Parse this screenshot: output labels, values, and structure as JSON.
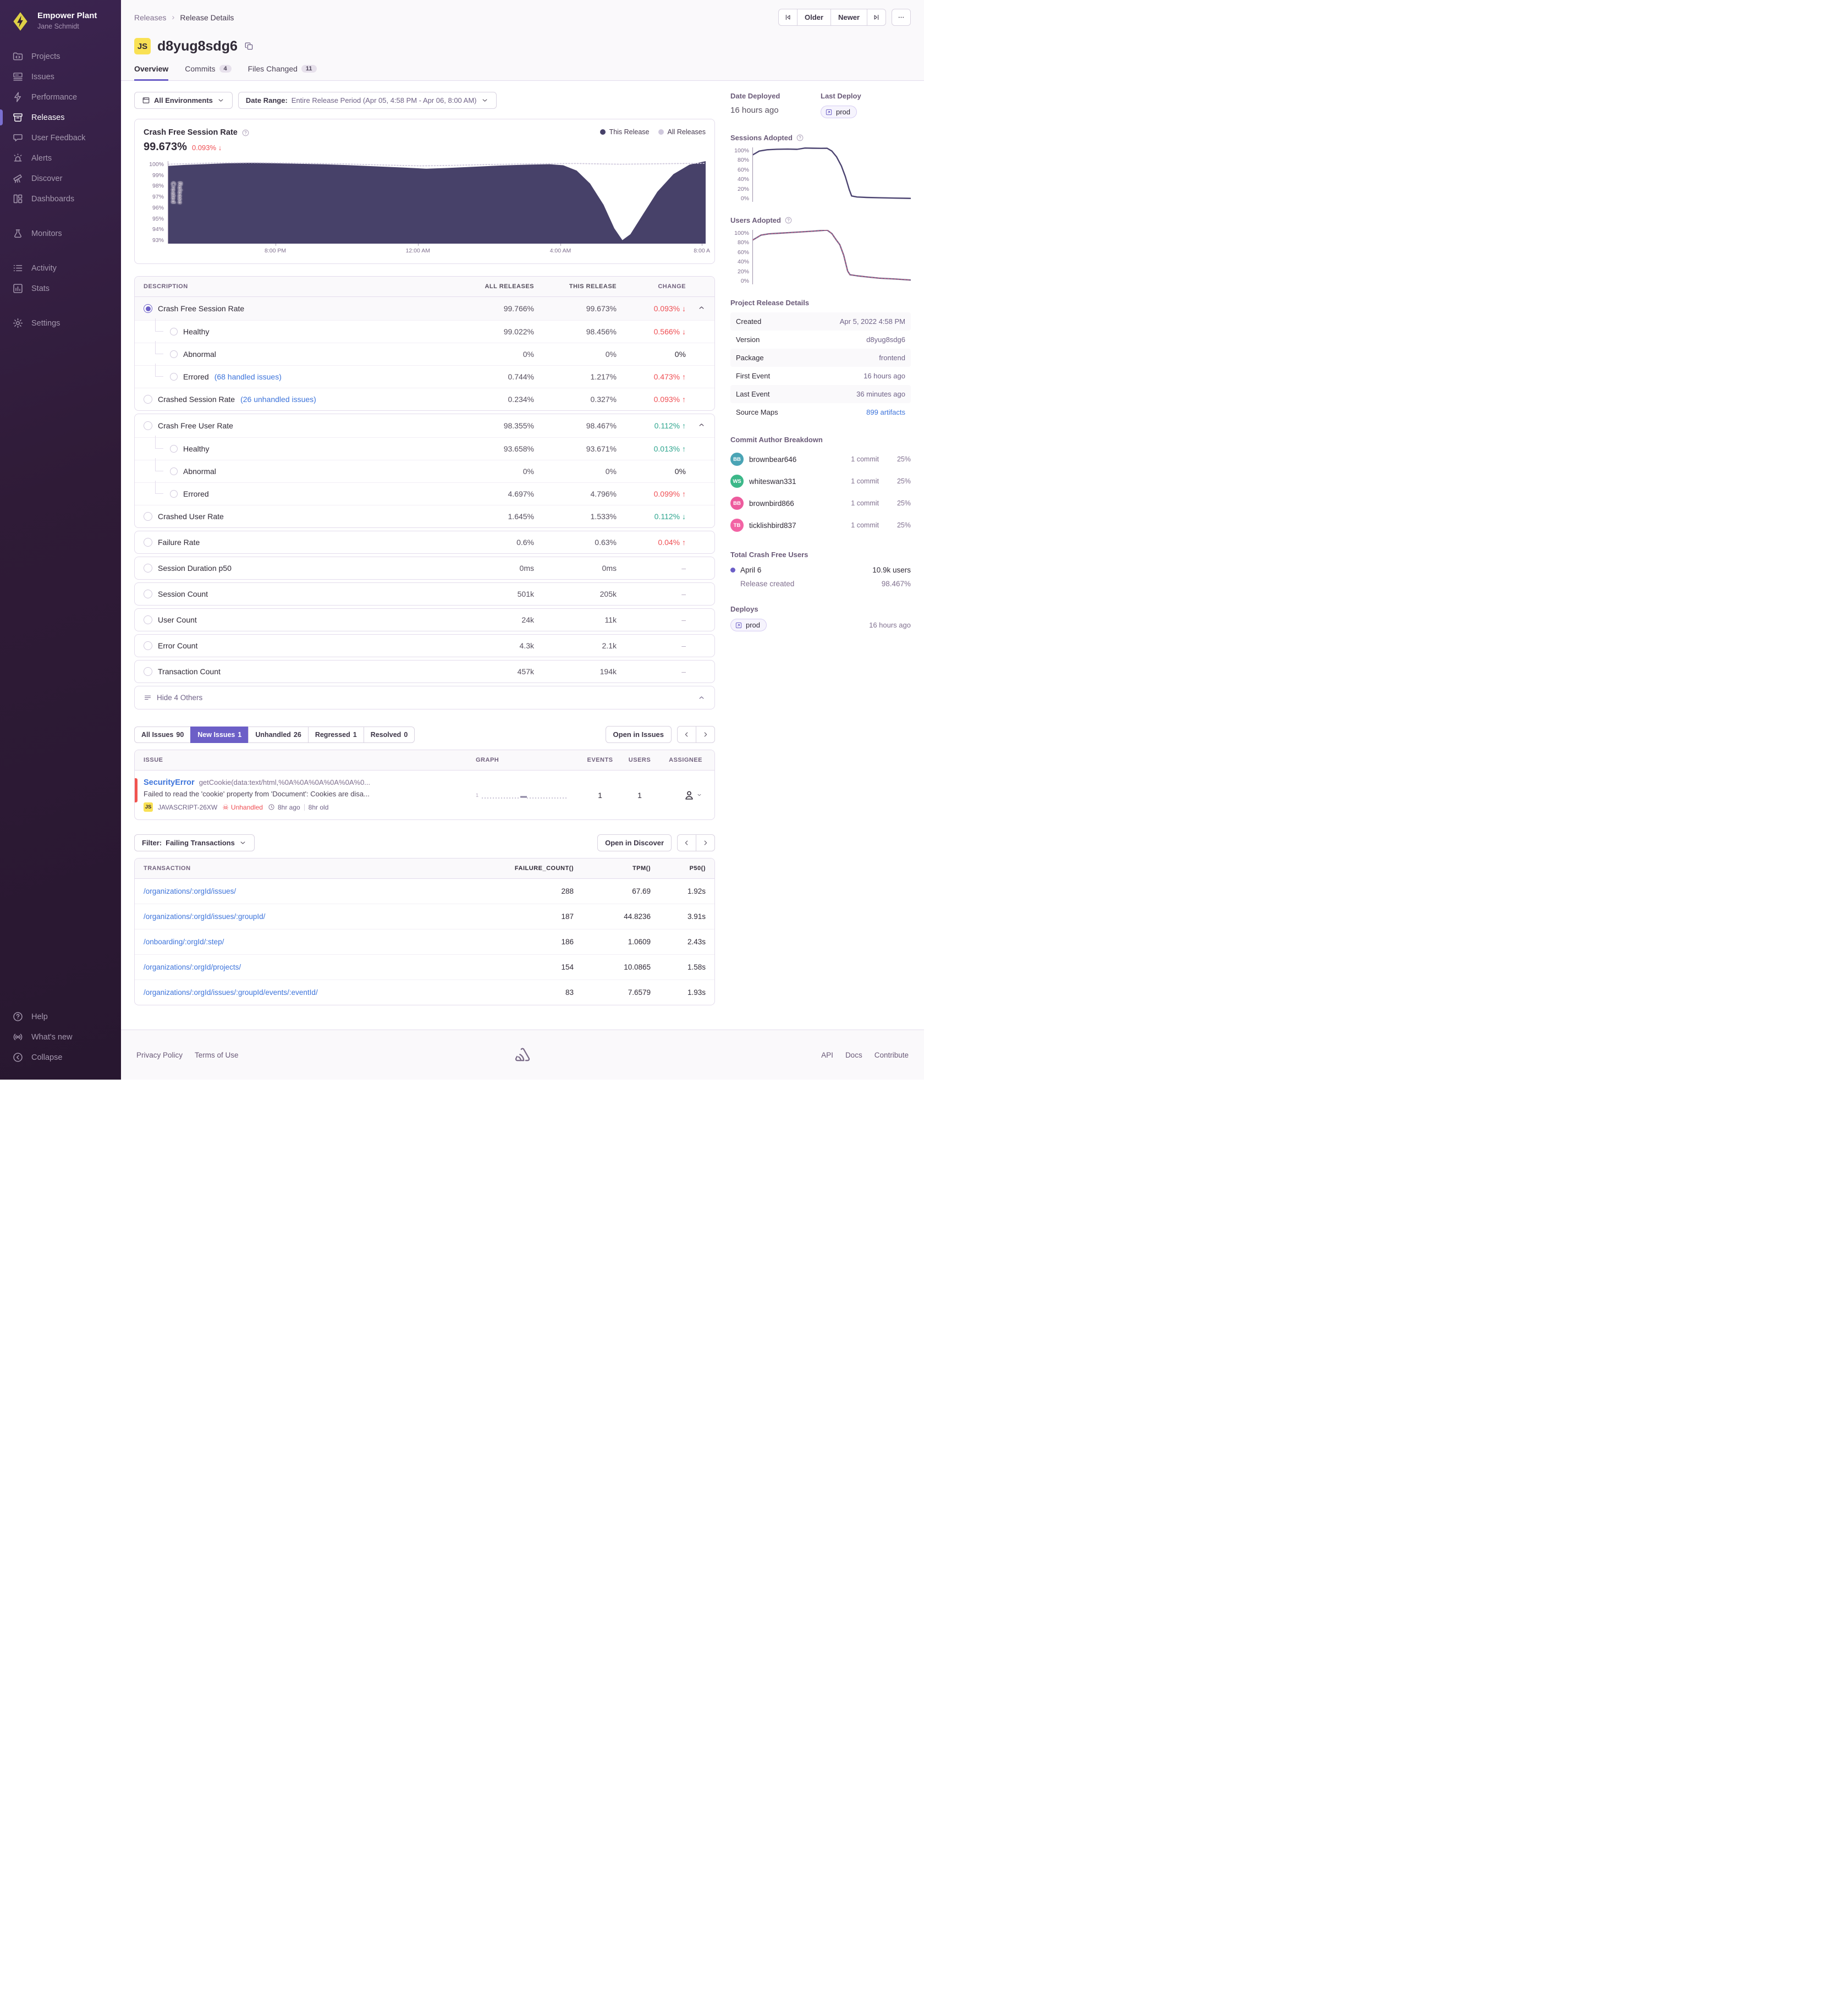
{
  "sidebar": {
    "org": "Empower Plant",
    "user": "Jane Schmidt",
    "groups": [
      [
        {
          "label": "Projects",
          "icon": "projects"
        },
        {
          "label": "Issues",
          "icon": "issues"
        },
        {
          "label": "Performance",
          "icon": "performance"
        },
        {
          "label": "Releases",
          "icon": "releases",
          "active": true
        },
        {
          "label": "User Feedback",
          "icon": "feedback"
        },
        {
          "label": "Alerts",
          "icon": "alerts"
        },
        {
          "label": "Discover",
          "icon": "discover"
        },
        {
          "label": "Dashboards",
          "icon": "dashboards"
        }
      ],
      [
        {
          "label": "Monitors",
          "icon": "monitors"
        }
      ],
      [
        {
          "label": "Activity",
          "icon": "activity"
        },
        {
          "label": "Stats",
          "icon": "stats"
        }
      ],
      [
        {
          "label": "Settings",
          "icon": "settings"
        }
      ]
    ],
    "bottom": [
      {
        "label": "Help",
        "icon": "help"
      },
      {
        "label": "What's new",
        "icon": "whatsnew"
      },
      {
        "label": "Collapse",
        "icon": "collapse"
      }
    ]
  },
  "header": {
    "breadcrumb": [
      "Releases",
      "Release Details"
    ],
    "nav": {
      "older": "Older",
      "newer": "Newer"
    },
    "title_badge": "JS",
    "title": "d8yug8sdg6",
    "tabs": [
      {
        "label": "Overview",
        "active": true
      },
      {
        "label": "Commits",
        "count": "4"
      },
      {
        "label": "Files Changed",
        "count": "11"
      }
    ]
  },
  "filters": {
    "environments": "All Environments",
    "date_range_label": "Date Range:",
    "date_range_value": "Entire Release Period (Apr 05, 4:58 PM - Apr 06, 8:00 AM)"
  },
  "chart_data": [
    {
      "type": "area",
      "title": "Crash Free Session Rate",
      "value": "99.673%",
      "change": "0.093%",
      "change_direction": "down",
      "change_color": "red",
      "annotation": "Release Created",
      "legend": [
        {
          "label": "This Release",
          "color": "#474169"
        },
        {
          "label": "All Releases",
          "color": "#cfc8dc"
        }
      ],
      "ylim": [
        93,
        100
      ],
      "y_ticks": [
        "100%",
        "99%",
        "98%",
        "97%",
        "96%",
        "95%",
        "94%",
        "93%"
      ],
      "x_ticks": [
        {
          "label": "8:00 PM",
          "pos": 0.2
        },
        {
          "label": "12:00 AM",
          "pos": 0.465
        },
        {
          "label": "4:00 AM",
          "pos": 0.73
        },
        {
          "label": "8:00 A",
          "pos": 0.993
        }
      ],
      "series": [
        {
          "name": "This Release",
          "points": [
            [
              0,
              99.6
            ],
            [
              0.03,
              99.68
            ],
            [
              0.07,
              99.75
            ],
            [
              0.11,
              99.82
            ],
            [
              0.15,
              99.86
            ],
            [
              0.19,
              99.83
            ],
            [
              0.24,
              99.78
            ],
            [
              0.29,
              99.73
            ],
            [
              0.34,
              99.65
            ],
            [
              0.39,
              99.55
            ],
            [
              0.44,
              99.45
            ],
            [
              0.48,
              99.36
            ],
            [
              0.52,
              99.42
            ],
            [
              0.57,
              99.53
            ],
            [
              0.62,
              99.63
            ],
            [
              0.67,
              99.7
            ],
            [
              0.71,
              99.74
            ],
            [
              0.735,
              99.65
            ],
            [
              0.76,
              99.2
            ],
            [
              0.785,
              98.1
            ],
            [
              0.81,
              96.3
            ],
            [
              0.83,
              94.3
            ],
            [
              0.845,
              93.3
            ],
            [
              0.86,
              93.8
            ],
            [
              0.885,
              95.6
            ],
            [
              0.91,
              97.4
            ],
            [
              0.94,
              98.9
            ],
            [
              0.97,
              99.7
            ],
            [
              1,
              100
            ]
          ]
        },
        {
          "name": "All Releases",
          "points": [
            [
              0,
              99.74
            ],
            [
              0.08,
              99.84
            ],
            [
              0.16,
              99.87
            ],
            [
              0.25,
              99.82
            ],
            [
              0.33,
              99.76
            ],
            [
              0.41,
              99.66
            ],
            [
              0.47,
              99.6
            ],
            [
              0.53,
              99.64
            ],
            [
              0.6,
              99.72
            ],
            [
              0.68,
              99.78
            ],
            [
              0.76,
              99.8
            ],
            [
              0.84,
              99.74
            ],
            [
              0.92,
              99.78
            ],
            [
              1,
              99.82
            ]
          ]
        }
      ]
    },
    {
      "type": "line",
      "title": "Sessions Adopted",
      "ylim": [
        0,
        100
      ],
      "y_ticks": [
        "100%",
        "80%",
        "60%",
        "40%",
        "20%",
        "0%"
      ],
      "points": [
        [
          0,
          86
        ],
        [
          0.04,
          93
        ],
        [
          0.09,
          95.5
        ],
        [
          0.15,
          96.5
        ],
        [
          0.22,
          96.8
        ],
        [
          0.28,
          96.4
        ],
        [
          0.33,
          98.8
        ],
        [
          0.38,
          98.4
        ],
        [
          0.43,
          98.2
        ],
        [
          0.47,
          98.3
        ],
        [
          0.5,
          93
        ],
        [
          0.53,
          82
        ],
        [
          0.56,
          65
        ],
        [
          0.585,
          45
        ],
        [
          0.61,
          20
        ],
        [
          0.625,
          8
        ],
        [
          0.66,
          6
        ],
        [
          0.72,
          5.2
        ],
        [
          0.8,
          4.6
        ],
        [
          0.9,
          4
        ],
        [
          1,
          3.4
        ]
      ]
    },
    {
      "type": "line",
      "title": "Users Adopted",
      "ylim": [
        0,
        100
      ],
      "y_ticks": [
        "100%",
        "80%",
        "60%",
        "40%",
        "20%",
        "0%"
      ],
      "points": [
        [
          0,
          81
        ],
        [
          0.05,
          90
        ],
        [
          0.1,
          92.5
        ],
        [
          0.17,
          93.8
        ],
        [
          0.24,
          95
        ],
        [
          0.31,
          96.3
        ],
        [
          0.38,
          97.6
        ],
        [
          0.44,
          99
        ],
        [
          0.47,
          99.6
        ],
        [
          0.5,
          93
        ],
        [
          0.53,
          80
        ],
        [
          0.55,
          72
        ],
        [
          0.575,
          52
        ],
        [
          0.6,
          22
        ],
        [
          0.615,
          15
        ],
        [
          0.66,
          13
        ],
        [
          0.72,
          11
        ],
        [
          0.8,
          8.5
        ],
        [
          0.9,
          7
        ],
        [
          1,
          5
        ]
      ]
    }
  ],
  "metrics": {
    "columns": [
      "DESCRIPTION",
      "ALL RELEASES",
      "THIS RELEASE",
      "CHANGE"
    ],
    "groups": [
      {
        "rows": [
          {
            "label": "Crash Free Session Rate",
            "radio": "selected",
            "all": "99.766%",
            "this": "99.673%",
            "change": "0.093%",
            "arrow": "down",
            "change_color": "red",
            "chevron": true,
            "selected_bg": true
          },
          {
            "label": "Healthy",
            "indent": true,
            "radio": "sub",
            "all": "99.022%",
            "this": "98.456%",
            "change": "0.566%",
            "arrow": "down",
            "change_color": "red"
          },
          {
            "label": "Abnormal",
            "indent": true,
            "radio": "sub",
            "all": "0%",
            "this": "0%",
            "change": "0%",
            "change_color": "plain"
          },
          {
            "label": "Errored",
            "link": "(68 handled issues)",
            "indent": true,
            "radio": "sub",
            "all": "0.744%",
            "this": "1.217%",
            "change": "0.473%",
            "arrow": "up",
            "change_color": "red"
          },
          {
            "label": "Crashed Session Rate",
            "link": "(26 unhandled issues)",
            "radio": "unselected",
            "all": "0.234%",
            "this": "0.327%",
            "change": "0.093%",
            "arrow": "up",
            "change_color": "red"
          }
        ]
      },
      {
        "rows": [
          {
            "label": "Crash Free User Rate",
            "radio": "unselected",
            "all": "98.355%",
            "this": "98.467%",
            "change": "0.112%",
            "arrow": "up",
            "change_color": "green",
            "chevron": true
          },
          {
            "label": "Healthy",
            "indent": true,
            "radio": "sub",
            "all": "93.658%",
            "this": "93.671%",
            "change": "0.013%",
            "arrow": "up",
            "change_color": "green"
          },
          {
            "label": "Abnormal",
            "indent": true,
            "radio": "sub",
            "all": "0%",
            "this": "0%",
            "change": "0%",
            "change_color": "plain"
          },
          {
            "label": "Errored",
            "indent": true,
            "radio": "sub",
            "all": "4.697%",
            "this": "4.796%",
            "change": "0.099%",
            "arrow": "up",
            "change_color": "red"
          },
          {
            "label": "Crashed User Rate",
            "radio": "unselected",
            "all": "1.645%",
            "this": "1.533%",
            "change": "0.112%",
            "arrow": "down",
            "change_color": "green"
          }
        ]
      },
      {
        "rows": [
          {
            "label": "Failure Rate",
            "radio": "unselected",
            "all": "0.6%",
            "this": "0.63%",
            "change": "0.04%",
            "arrow": "up",
            "change_color": "red"
          }
        ]
      },
      {
        "rows": [
          {
            "label": "Session Duration p50",
            "radio": "unselected",
            "all": "0ms",
            "this": "0ms",
            "change": "–",
            "change_color": "muted"
          }
        ]
      },
      {
        "rows": [
          {
            "label": "Session Count",
            "radio": "unselected",
            "all": "501k",
            "this": "205k",
            "change": "–",
            "change_color": "muted"
          }
        ]
      },
      {
        "rows": [
          {
            "label": "User Count",
            "radio": "unselected",
            "all": "24k",
            "this": "11k",
            "change": "–",
            "change_color": "muted"
          }
        ]
      },
      {
        "rows": [
          {
            "label": "Error Count",
            "radio": "unselected",
            "all": "4.3k",
            "this": "2.1k",
            "change": "–",
            "change_color": "muted"
          }
        ]
      },
      {
        "rows": [
          {
            "label": "Transaction Count",
            "radio": "unselected",
            "all": "457k",
            "this": "194k",
            "change": "–",
            "change_color": "muted"
          }
        ]
      }
    ],
    "footer_label": "Hide 4 Others"
  },
  "issues": {
    "tabs": [
      {
        "label": "All Issues",
        "count": "90"
      },
      {
        "label": "New Issues",
        "count": "1",
        "active": true
      },
      {
        "label": "Unhandled",
        "count": "26"
      },
      {
        "label": "Regressed",
        "count": "1"
      },
      {
        "label": "Resolved",
        "count": "0"
      }
    ],
    "open_button": "Open in Issues",
    "columns": [
      "ISSUE",
      "GRAPH",
      "EVENTS",
      "USERS",
      "ASSIGNEE"
    ],
    "issue": {
      "title": "SecurityError",
      "culprit": "getCookie(data:text/html,%0A%0A%0A%0A%0A%0...",
      "message": "Failed to read the 'cookie' property from 'Document': Cookies are disa...",
      "project_badge": "JS",
      "short_id": "JAVASCRIPT-26XW",
      "unhandled_label": "Unhandled",
      "age_ago": "8hr ago",
      "age_old": "8hr old",
      "graph_axis_label": "1",
      "events": "1",
      "users": "1"
    }
  },
  "transactions": {
    "filter_label": "Filter:",
    "filter_value": "Failing Transactions",
    "open_button": "Open in Discover",
    "columns": [
      "TRANSACTION",
      "FAILURE_COUNT()",
      "TPM()",
      "P50()"
    ],
    "rows": [
      {
        "transaction": "/organizations/:orgId/issues/",
        "failure_count": "288",
        "tpm": "67.69",
        "p50": "1.92s"
      },
      {
        "transaction": "/organizations/:orgId/issues/:groupId/",
        "failure_count": "187",
        "tpm": "44.8236",
        "p50": "3.91s"
      },
      {
        "transaction": "/onboarding/:orgId/:step/",
        "failure_count": "186",
        "tpm": "1.0609",
        "p50": "2.43s"
      },
      {
        "transaction": "/organizations/:orgId/projects/",
        "failure_count": "154",
        "tpm": "10.0865",
        "p50": "1.58s"
      },
      {
        "transaction": "/organizations/:orgId/issues/:groupId/events/:eventId/",
        "failure_count": "83",
        "tpm": "7.6579",
        "p50": "1.93s"
      }
    ]
  },
  "aside": {
    "date_deployed_label": "Date Deployed",
    "date_deployed": "16 hours ago",
    "last_deploy_label": "Last Deploy",
    "last_deploy_env": "prod",
    "details_label": "Project Release Details",
    "details": [
      {
        "key": "Created",
        "value": "Apr 5, 2022 4:58 PM",
        "striped": true
      },
      {
        "key": "Version",
        "value": "d8yug8sdg6"
      },
      {
        "key": "Package",
        "value": "frontend",
        "striped": true
      },
      {
        "key": "First Event",
        "value": "16 hours ago"
      },
      {
        "key": "Last Event",
        "value": "36 minutes ago",
        "striped": true
      },
      {
        "key": "Source Maps",
        "value": "899 artifacts",
        "link": true
      }
    ],
    "commit_breakdown_label": "Commit Author Breakdown",
    "authors": [
      {
        "initials": "BB",
        "name": "brownbear646",
        "commits": "1 commit",
        "pct": "25%",
        "color": "#4aa4b5"
      },
      {
        "initials": "WS",
        "name": "whiteswan331",
        "commits": "1 commit",
        "pct": "25%",
        "color": "#3cb889"
      },
      {
        "initials": "BB",
        "name": "brownbird866",
        "commits": "1 commit",
        "pct": "25%",
        "color": "#ed5b9d"
      },
      {
        "initials": "TB",
        "name": "ticklishbird837",
        "commits": "1 commit",
        "pct": "25%",
        "color": "#f263a4"
      }
    ],
    "total_cfu_label": "Total Crash Free Users",
    "cfu_rows": [
      {
        "label": "April 6",
        "value": "10.9k users",
        "dot": true
      },
      {
        "label": "Release created",
        "value": "98.467%",
        "sub": true
      }
    ],
    "deploys_label": "Deploys",
    "deploy_env": "prod",
    "deploy_time": "16 hours ago"
  },
  "footer": {
    "links_left": [
      "Privacy Policy",
      "Terms of Use"
    ],
    "links_right": [
      "API",
      "Docs",
      "Contribute"
    ]
  }
}
